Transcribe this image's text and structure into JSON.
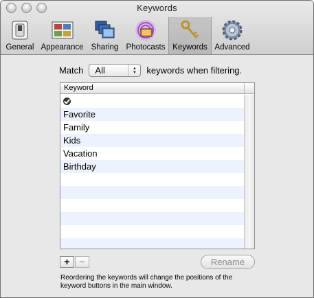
{
  "window": {
    "title": "Keywords"
  },
  "toolbar": {
    "items": [
      {
        "label": "General",
        "icon": "switch-icon"
      },
      {
        "label": "Appearance",
        "icon": "appearance-icon"
      },
      {
        "label": "Sharing",
        "icon": "sharing-icon"
      },
      {
        "label": "Photocasts",
        "icon": "photocasts-icon"
      },
      {
        "label": "Keywords",
        "icon": "keys-icon",
        "selected": true
      },
      {
        "label": "Advanced",
        "icon": "gear-icon"
      }
    ]
  },
  "filter": {
    "prefix": "Match",
    "selected_option": "All",
    "suffix": "keywords when filtering."
  },
  "table": {
    "column_header": "Keyword",
    "rows": [
      {
        "label": "",
        "icon": "checkmark-icon"
      },
      {
        "label": "Favorite"
      },
      {
        "label": "Family"
      },
      {
        "label": "Kids"
      },
      {
        "label": "Vacation"
      },
      {
        "label": "Birthday"
      },
      {
        "label": ""
      },
      {
        "label": ""
      },
      {
        "label": ""
      },
      {
        "label": ""
      },
      {
        "label": ""
      },
      {
        "label": ""
      }
    ]
  },
  "buttons": {
    "add": "+",
    "remove": "−",
    "rename": "Rename"
  },
  "note": "Reordering the keywords will change the positions of the keyword buttons in the main window."
}
